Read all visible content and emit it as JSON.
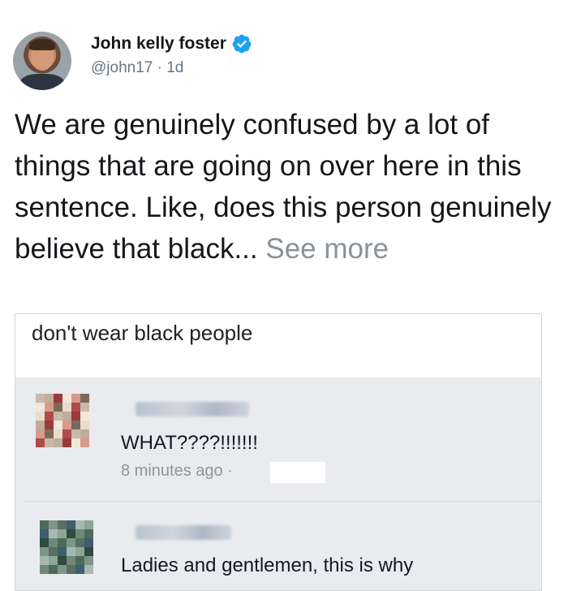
{
  "tweet": {
    "author_name": "John kelly foster",
    "handle_time": "@john17 · 1d",
    "body_text": "We are genuinely confused by a lot of things that are going on over here in this sentence. Like, does this person genuinely believe that black...",
    "see_more": "See more"
  },
  "embedded_post": {
    "caption": "don't wear black people",
    "comments": [
      {
        "text": "WHAT????!!!!!!!",
        "meta": "8 minutes ago ·"
      },
      {
        "text": "Ladies and gentlemen, this is why"
      }
    ]
  },
  "colors": {
    "verified_blue": "#1da1f2",
    "handle_gray": "#657786",
    "comments_bg": "#e9ebee"
  }
}
